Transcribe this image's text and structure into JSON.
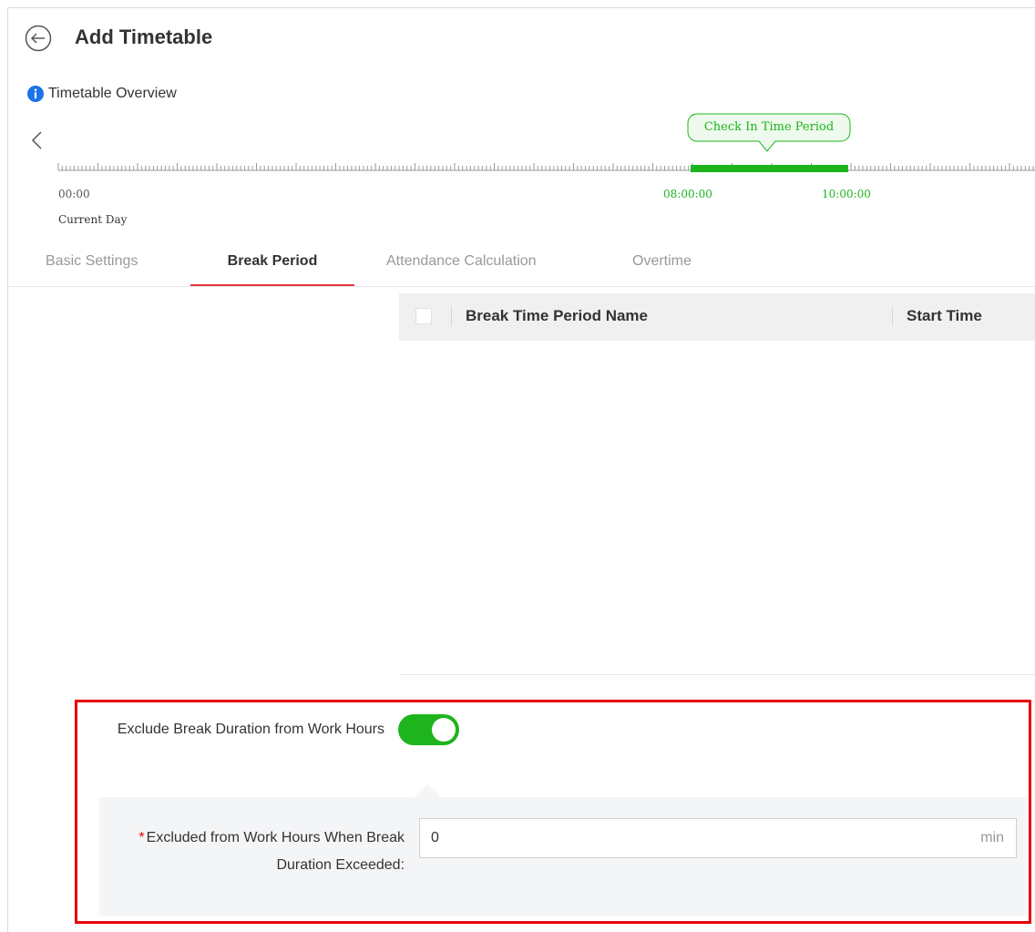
{
  "header": {
    "title": "Add Timetable",
    "overview_label": "Timetable Overview"
  },
  "timeline": {
    "start_label": "00:00",
    "highlight_start_label": "08:00:00",
    "highlight_end_label": "10:00:00",
    "day_label": "Current Day",
    "period_label": "Check In Time Period"
  },
  "tabs": [
    {
      "label": "Basic Settings",
      "active": false
    },
    {
      "label": "Break Period",
      "active": true
    },
    {
      "label": "Attendance Calculation",
      "active": false
    },
    {
      "label": "Overtime",
      "active": false
    }
  ],
  "table": {
    "columns": [
      "Break Time Period Name",
      "Start Time"
    ],
    "rows": []
  },
  "settings": {
    "exclude_label": "Exclude Break Duration from Work Hours",
    "exclude_enabled": true,
    "excluded_label_required": "*",
    "excluded_label": "Excluded from Work Hours When Break Duration Exceeded:",
    "excluded_value": "0",
    "excluded_unit": "min"
  },
  "colors": {
    "accent_green": "#1db41d",
    "tab_underline": "#e4393c",
    "highlight_border": "#e8000b",
    "info_blue": "#1a73e8"
  },
  "icons": {
    "back": "back-arrow-circle-icon",
    "info": "info-icon",
    "prev": "chevron-left-icon"
  }
}
